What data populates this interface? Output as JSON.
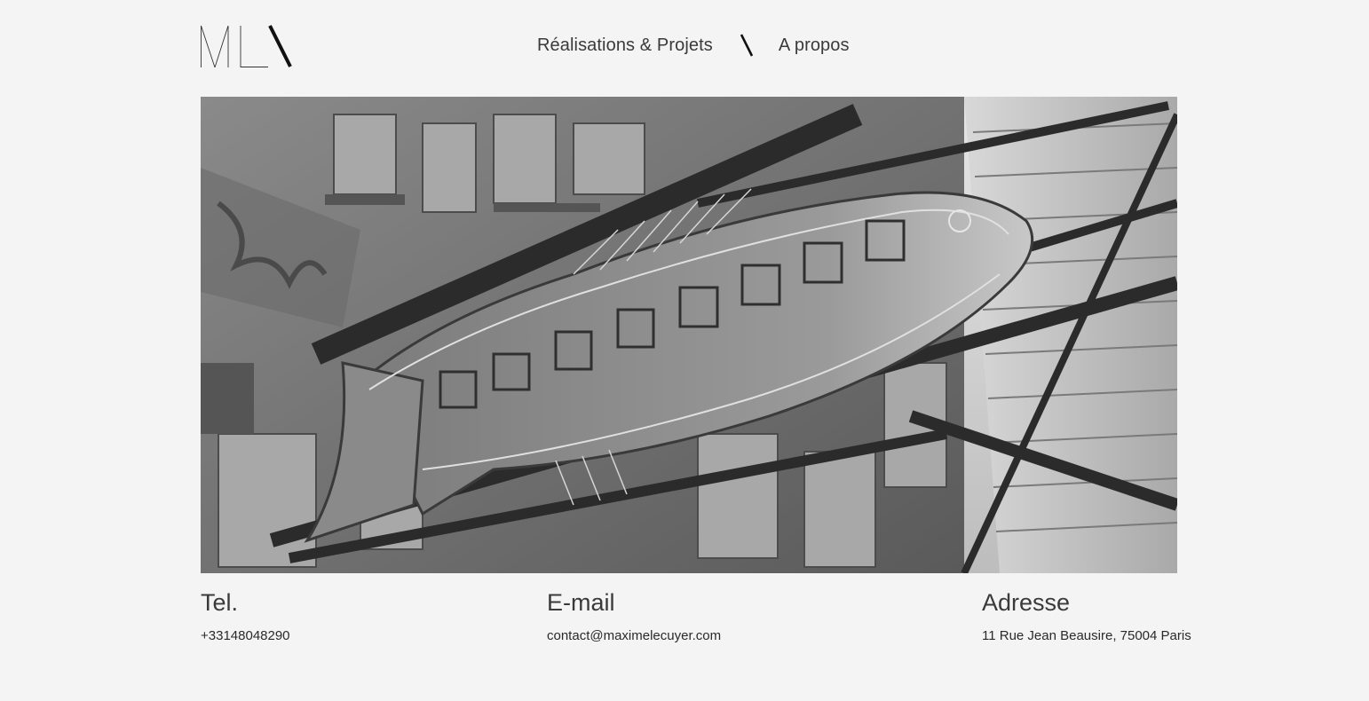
{
  "nav": {
    "items": [
      {
        "label": "Réalisations & Projets"
      },
      {
        "label": "A propos"
      }
    ]
  },
  "hero": {
    "image_description_icon": "neon-fish-sign-photo"
  },
  "contact": {
    "tel": {
      "title": "Tel.",
      "value": "+33148048290"
    },
    "email": {
      "title": "E-mail",
      "value": "contact@maximelecuyer.com"
    },
    "address": {
      "title": "Adresse",
      "value": "11 Rue Jean Beausire, 75004 Paris"
    }
  },
  "colors": {
    "background": "#f4f4f4",
    "text": "#2a2a2a",
    "accent": "#000000"
  }
}
